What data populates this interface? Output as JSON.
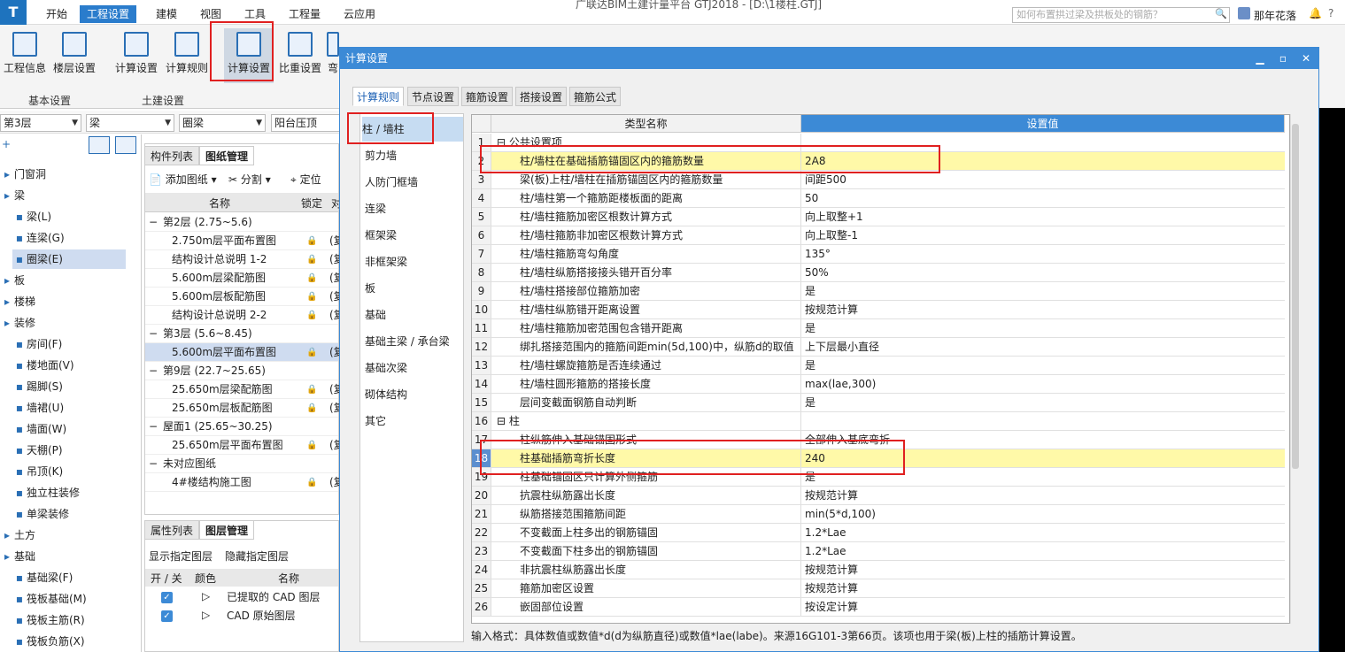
{
  "menu": {
    "logo": "T",
    "tabs": [
      "开始",
      "工程设置",
      "建模",
      "视图",
      "工具",
      "工程量",
      "云应用"
    ],
    "title": "广联达BIM土建计量平台 GTJ2018 - [D:\\1楼柱.GTJ]",
    "search_placeholder": "如何布置拱过梁及拱板处的钢筋？",
    "user": "那年花落"
  },
  "ribbon": {
    "buttons": [
      "工程信息",
      "楼层设置",
      "计算设置",
      "计算规则",
      "计算设置",
      "比重设置",
      "弯"
    ],
    "groups": [
      "基本设置",
      "土建设置"
    ]
  },
  "toolbar": {
    "floor": "第3层",
    "type": "梁",
    "subtype": "圈梁",
    "layer": "阳台压顶"
  },
  "tree": [
    "门窗洞",
    "梁",
    "梁(L)",
    "连梁(G)",
    "圈梁(E)",
    "板",
    "楼梯",
    "装修",
    "房间(F)",
    "楼地面(V)",
    "踢脚(S)",
    "墙裙(U)",
    "墙面(W)",
    "天棚(P)",
    "吊顶(K)",
    "独立柱装修",
    "单梁装修",
    "土方",
    "基础",
    "基础梁(F)",
    "筏板基础(M)",
    "筏板主筋(R)",
    "筏板负筋(X)"
  ],
  "drawing_panel": {
    "tabs": [
      "构件列表",
      "图纸管理"
    ],
    "actions": [
      "添加图纸",
      "分割",
      "定位"
    ],
    "headers": [
      "名称",
      "锁定",
      "对"
    ],
    "rows": [
      {
        "t": "第2层 (2.75~5.6)",
        "g": true
      },
      {
        "t": "2.750m层平面布置图",
        "c": "(复"
      },
      {
        "t": "结构设计总说明 1-2",
        "c": "(复"
      },
      {
        "t": "5.600m层梁配筋图",
        "c": "(复"
      },
      {
        "t": "5.600m层板配筋图",
        "c": "(复"
      },
      {
        "t": "结构设计总说明 2-2",
        "c": "(复"
      },
      {
        "t": "第3层 (5.6~8.45)",
        "g": true
      },
      {
        "t": "5.600m层平面布置图",
        "c": "(复"
      },
      {
        "t": "第9层 (22.7~25.65)",
        "g": true
      },
      {
        "t": "25.650m层梁配筋图",
        "c": "(复"
      },
      {
        "t": "25.650m层板配筋图",
        "c": "(复"
      },
      {
        "t": "屋面1 (25.65~30.25)",
        "g": true
      },
      {
        "t": "25.650m层平面布置图",
        "c": "(复"
      },
      {
        "t": "未对应图纸",
        "g": true
      },
      {
        "t": "4#楼结构施工图",
        "c": "(复"
      }
    ]
  },
  "layer_panel": {
    "tabs": [
      "属性列表",
      "图层管理"
    ],
    "actions": [
      "显示指定图层",
      "隐藏指定图层"
    ],
    "headers": [
      "开 / 关",
      "颜色",
      "名称"
    ],
    "rows": [
      "已提取的 CAD 图层",
      "CAD 原始图层"
    ]
  },
  "dialog": {
    "title": "计算设置",
    "tabs": [
      "计算规则",
      "节点设置",
      "箍筋设置",
      "搭接设置",
      "箍筋公式"
    ],
    "categories": [
      "柱 / 墙柱",
      "剪力墙",
      "人防门框墙",
      "连梁",
      "框架梁",
      "非框架梁",
      "板",
      "基础",
      "基础主梁 / 承台梁",
      "基础次梁",
      "砌体结构",
      "其它"
    ],
    "col_name": "类型名称",
    "col_value": "设置值",
    "rows": [
      {
        "n": "1",
        "name": "公共设置项",
        "value": "",
        "sec": true
      },
      {
        "n": "2",
        "name": "柱/墙柱在基础插筋锚固区内的箍筋数量",
        "value": "2A8",
        "hl": true
      },
      {
        "n": "3",
        "name": "梁(板)上柱/墙柱在插筋锚固区内的箍筋数量",
        "value": "间距500"
      },
      {
        "n": "4",
        "name": "柱/墙柱第一个箍筋距楼板面的距离",
        "value": "50"
      },
      {
        "n": "5",
        "name": "柱/墙柱箍筋加密区根数计算方式",
        "value": "向上取整+1"
      },
      {
        "n": "6",
        "name": "柱/墙柱箍筋非加密区根数计算方式",
        "value": "向上取整-1"
      },
      {
        "n": "7",
        "name": "柱/墙柱箍筋弯勾角度",
        "value": "135°"
      },
      {
        "n": "8",
        "name": "柱/墙柱纵筋搭接接头错开百分率",
        "value": "50%"
      },
      {
        "n": "9",
        "name": "柱/墙柱搭接部位箍筋加密",
        "value": "是"
      },
      {
        "n": "10",
        "name": "柱/墙柱纵筋错开距离设置",
        "value": "按规范计算"
      },
      {
        "n": "11",
        "name": "柱/墙柱箍筋加密范围包含错开距离",
        "value": "是"
      },
      {
        "n": "12",
        "name": "绑扎搭接范围内的箍筋间距min(5d,100)中，纵筋d的取值",
        "value": "上下层最小直径"
      },
      {
        "n": "13",
        "name": "柱/墙柱螺旋箍筋是否连续通过",
        "value": "是"
      },
      {
        "n": "14",
        "name": "柱/墙柱圆形箍筋的搭接长度",
        "value": "max(lae,300)"
      },
      {
        "n": "15",
        "name": "层间变截面钢筋自动判断",
        "value": "是"
      },
      {
        "n": "16",
        "name": "柱",
        "value": "",
        "sec": true
      },
      {
        "n": "17",
        "name": "柱纵筋伸入基础锚固形式",
        "value": "全部伸入基底弯折"
      },
      {
        "n": "18",
        "name": "柱基础插筋弯折长度",
        "value": "240",
        "hl": true,
        "sel": true
      },
      {
        "n": "19",
        "name": "柱基础锚固区只计算外侧箍筋",
        "value": "是"
      },
      {
        "n": "20",
        "name": "抗震柱纵筋露出长度",
        "value": "按规范计算"
      },
      {
        "n": "21",
        "name": "纵筋搭接范围箍筋间距",
        "value": "min(5*d,100)"
      },
      {
        "n": "22",
        "name": "不变截面上柱多出的钢筋锚固",
        "value": "1.2*Lae"
      },
      {
        "n": "23",
        "name": "不变截面下柱多出的钢筋锚固",
        "value": "1.2*Lae"
      },
      {
        "n": "24",
        "name": "非抗震柱纵筋露出长度",
        "value": "按规范计算"
      },
      {
        "n": "25",
        "name": "箍筋加密区设置",
        "value": "按规范计算"
      },
      {
        "n": "26",
        "name": "嵌固部位设置",
        "value": "按设定计算"
      }
    ],
    "note": "输入格式：具体数值或数值*d(d为纵筋直径)或数值*lae(labe)。来源16G101-3第66页。该项也用于梁(板)上柱的插筋计算设置。"
  },
  "colors": {
    "accent": "#2a7ccc",
    "highlight": "#fff9a8",
    "annotation": "#e02020"
  }
}
